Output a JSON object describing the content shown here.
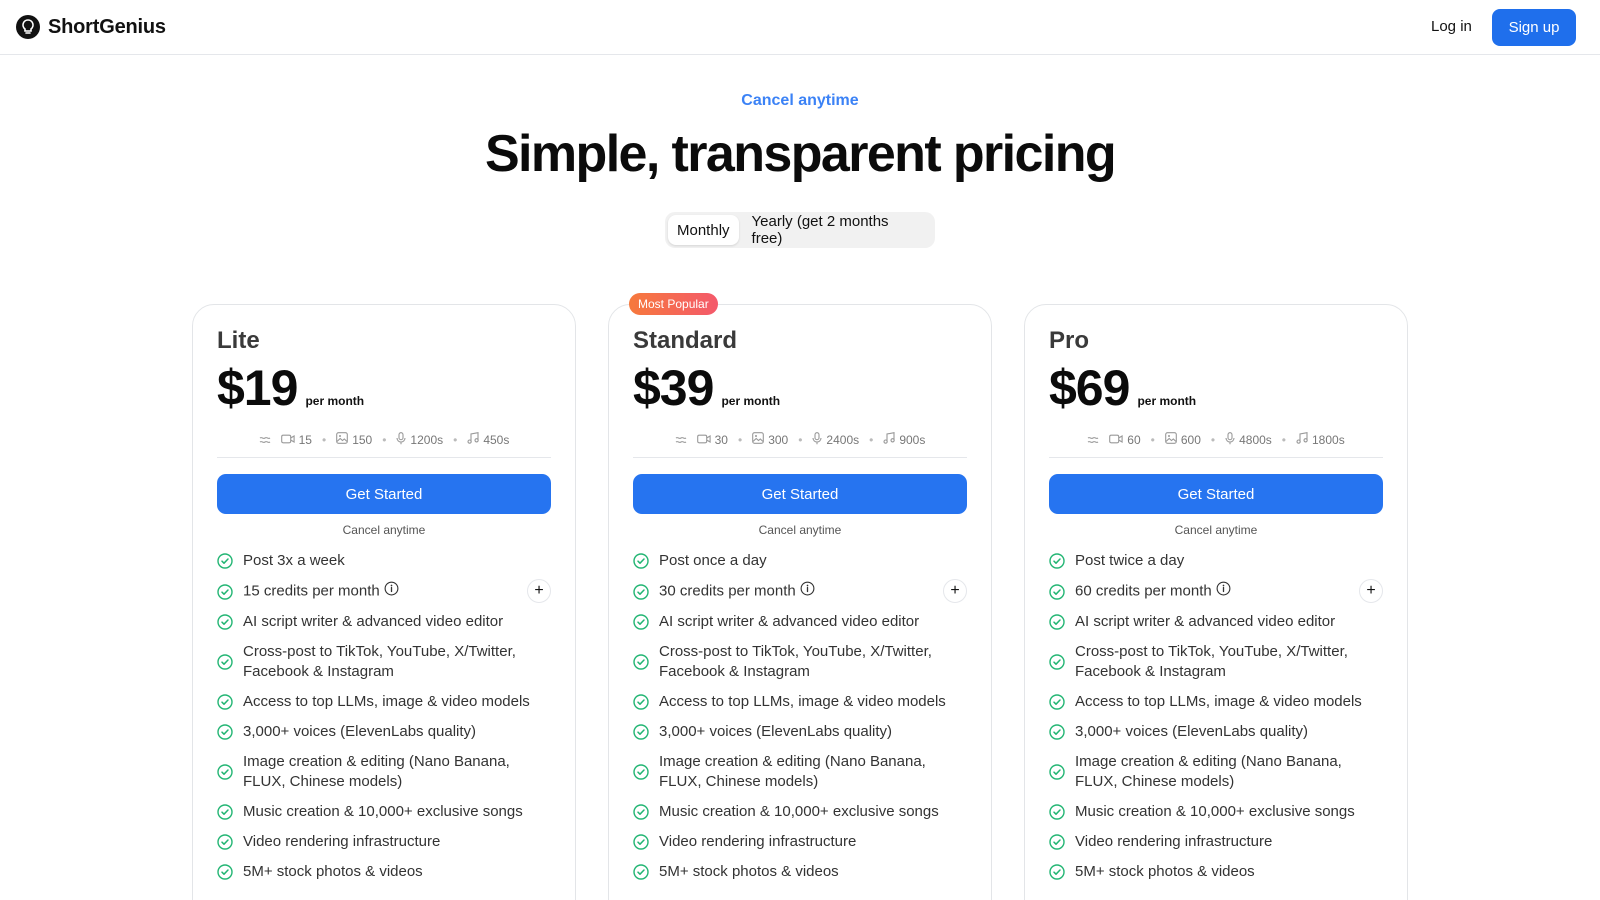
{
  "header": {
    "brand": "ShortGenius",
    "login": "Log in",
    "signup": "Sign up"
  },
  "hero": {
    "eyebrow": "Cancel anytime",
    "title": "Simple, transparent pricing",
    "toggle": {
      "monthly": "Monthly",
      "yearly": "Yearly (get 2 months free)",
      "selected": "Monthly"
    }
  },
  "plans": [
    {
      "name": "Lite",
      "price": "$19",
      "per": "per month",
      "stats": {
        "video": "15",
        "image": "150",
        "voice": "1200s",
        "music": "450s"
      },
      "cta": "Get Started",
      "cancel": "Cancel anytime",
      "features": [
        "Post 3x a week",
        "15 credits per month",
        "AI script writer & advanced video editor",
        "Cross-post to TikTok, YouTube, X/Twitter, Facebook & Instagram",
        "Access to top LLMs, image & video models",
        "3,000+ voices (ElevenLabs quality)",
        "Image creation & editing (Nano Banana, FLUX, Chinese models)",
        "Music creation & 10,000+ exclusive songs",
        "Video rendering infrastructure",
        "5M+ stock photos & videos"
      ]
    },
    {
      "name": "Standard",
      "badge": "Most Popular",
      "price": "$39",
      "per": "per month",
      "stats": {
        "video": "30",
        "image": "300",
        "voice": "2400s",
        "music": "900s"
      },
      "cta": "Get Started",
      "cancel": "Cancel anytime",
      "features": [
        "Post once a day",
        "30 credits per month",
        "AI script writer & advanced video editor",
        "Cross-post to TikTok, YouTube, X/Twitter, Facebook & Instagram",
        "Access to top LLMs, image & video models",
        "3,000+ voices (ElevenLabs quality)",
        "Image creation & editing (Nano Banana, FLUX, Chinese models)",
        "Music creation & 10,000+ exclusive songs",
        "Video rendering infrastructure",
        "5M+ stock photos & videos"
      ]
    },
    {
      "name": "Pro",
      "price": "$69",
      "per": "per month",
      "stats": {
        "video": "60",
        "image": "600",
        "voice": "4800s",
        "music": "1800s"
      },
      "cta": "Get Started",
      "cancel": "Cancel anytime",
      "features": [
        "Post twice a day",
        "60 credits per month",
        "AI script writer & advanced video editor",
        "Cross-post to TikTok, YouTube, X/Twitter, Facebook & Instagram",
        "Access to top LLMs, image & video models",
        "3,000+ voices (ElevenLabs quality)",
        "Image creation & editing (Nano Banana, FLUX, Chinese models)",
        "Music creation & 10,000+ exclusive songs",
        "Video rendering infrastructure",
        "5M+ stock photos & videos"
      ]
    }
  ],
  "colors": {
    "accent": "#2674f0",
    "eyebrow": "#3b82f6",
    "check": "#22b573",
    "badge_from": "#f6793c",
    "badge_to": "#f4596b"
  },
  "icons": {
    "brand": "lightbulb-icon",
    "stats": [
      "waves-icon",
      "video-icon",
      "image-icon",
      "mic-icon",
      "music-note-icon"
    ],
    "feature": "check-circle-icon",
    "info": "info-icon",
    "expand": "plus-icon"
  }
}
